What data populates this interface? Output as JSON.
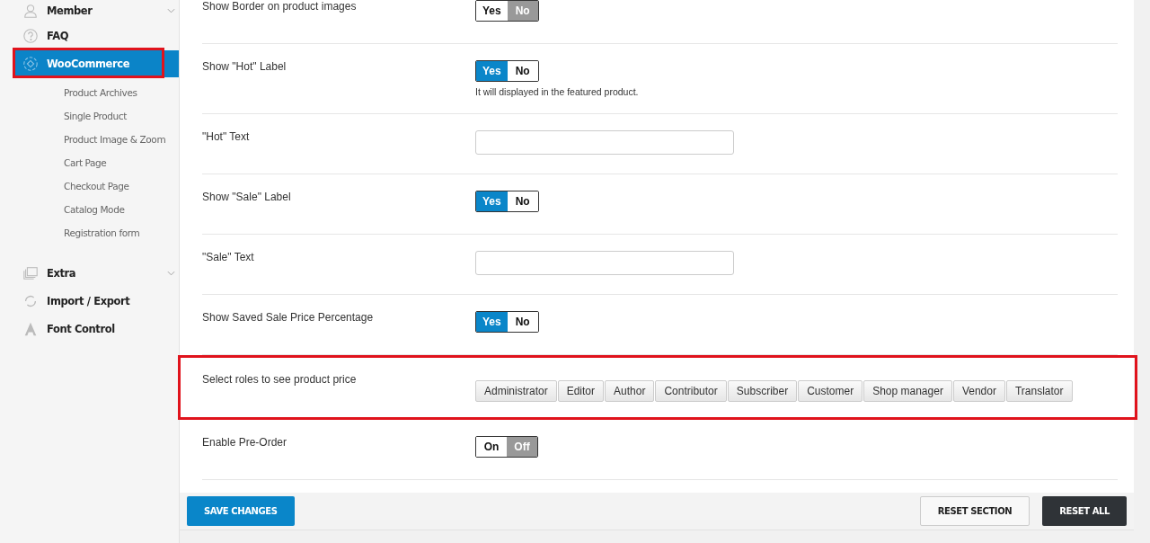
{
  "sidebar": {
    "items": [
      {
        "label": "Member",
        "expandable": true,
        "selected": false,
        "highlighted": false
      },
      {
        "label": "FAQ",
        "expandable": false,
        "selected": false,
        "highlighted": false
      },
      {
        "label": "WooCommerce",
        "expandable": false,
        "selected": true,
        "highlighted": true,
        "children": [
          {
            "label": "Product Archives"
          },
          {
            "label": "Single Product"
          },
          {
            "label": "Product Image & Zoom"
          },
          {
            "label": "Cart Page"
          },
          {
            "label": "Checkout Page"
          },
          {
            "label": "Catalog Mode"
          },
          {
            "label": "Registration form"
          }
        ]
      },
      {
        "label": "Extra",
        "expandable": true,
        "selected": false,
        "highlighted": false
      },
      {
        "label": "Import / Export",
        "expandable": false,
        "selected": false,
        "highlighted": false
      },
      {
        "label": "Font Control",
        "expandable": false,
        "selected": false,
        "highlighted": false
      }
    ]
  },
  "settings": [
    {
      "kind": "toggle",
      "label": "Show Border on product images",
      "on_label": "Yes",
      "off_label": "No",
      "on": false,
      "highlighted": false
    },
    {
      "kind": "toggle",
      "label": "Show \"Hot\" Label",
      "on_label": "Yes",
      "off_label": "No",
      "on": true,
      "description": "It will displayed in the featured product.",
      "highlighted": false
    },
    {
      "kind": "text",
      "label": "\"Hot\" Text",
      "highlighted": false
    },
    {
      "kind": "toggle",
      "label": "Show \"Sale\" Label",
      "on_label": "Yes",
      "off_label": "No",
      "on": true,
      "highlighted": false
    },
    {
      "kind": "text",
      "label": "\"Sale\" Text",
      "highlighted": false
    },
    {
      "kind": "toggle",
      "label": "Show Saved Sale Price Percentage",
      "on_label": "Yes",
      "off_label": "No",
      "on": true,
      "highlighted": false
    },
    {
      "kind": "roles",
      "label": "Select roles to see product price",
      "roles": [
        "Administrator",
        "Editor",
        "Author",
        "Contributor",
        "Subscriber",
        "Customer",
        "Shop manager",
        "Vendor",
        "Translator"
      ],
      "highlighted": true
    },
    {
      "kind": "toggle",
      "label": "Enable Pre-Order",
      "on_label": "On",
      "off_label": "Off",
      "on": false,
      "highlighted": false
    }
  ],
  "footer": {
    "save": "SAVE CHANGES",
    "reset_section": "RESET SECTION",
    "reset_all": "RESET ALL"
  }
}
